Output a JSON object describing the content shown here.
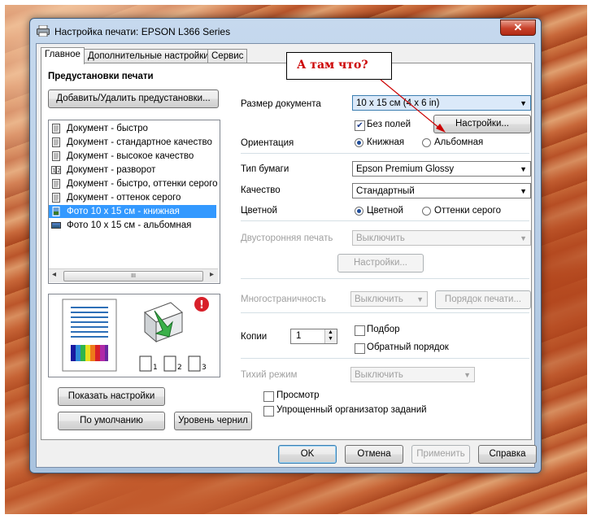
{
  "window": {
    "title": "Настройка печати: EPSON L366 Series",
    "close_glyph": "✕"
  },
  "tabs": [
    {
      "label": "Главное"
    },
    {
      "label": "Дополнительные настройки"
    },
    {
      "label": "Сервис"
    }
  ],
  "presets": {
    "heading": "Предустановки печати",
    "add_remove_button": "Добавить/Удалить предустановки...",
    "items": [
      {
        "label": "Документ - быстро",
        "icon": "document-icon"
      },
      {
        "label": "Документ - стандартное качество",
        "icon": "document-icon"
      },
      {
        "label": "Документ - высокое качество",
        "icon": "document-icon"
      },
      {
        "label": "Документ - разворот",
        "icon": "two-page-icon"
      },
      {
        "label": "Документ - быстро, оттенки серого",
        "icon": "document-icon"
      },
      {
        "label": "Документ - оттенок серого",
        "icon": "document-icon"
      },
      {
        "label": "Фото 10 x 15 см - книжная",
        "icon": "photo-portrait-icon",
        "selected": true
      },
      {
        "label": "Фото 10 x 15 см - альбомная",
        "icon": "photo-landscape-icon"
      }
    ],
    "scroll_thumb_glyph": "III",
    "scroll_left_glyph": "◂",
    "scroll_right_glyph": "▸"
  },
  "preview": {
    "copy_labels": [
      "1",
      "2",
      "3"
    ],
    "warning_glyph": "!"
  },
  "left_buttons": {
    "show_settings": "Показать настройки",
    "defaults": "По умолчанию",
    "ink_level": "Уровень чернил"
  },
  "settings": {
    "doc_size_label": "Размер документа",
    "doc_size_value": "10 x 15 см (4 x 6 in)",
    "borderless_label": "Без полей",
    "borderless_checked": true,
    "settings_button": "Настройки...",
    "orientation_label": "Ориентация",
    "orientation_portrait": "Книжная",
    "orientation_landscape": "Альбомная",
    "paper_type_label": "Тип бумаги",
    "paper_type_value": "Epson Premium Glossy",
    "quality_label": "Качество",
    "quality_value": "Стандартный",
    "color_label": "Цветной",
    "color_option": "Цветной",
    "grayscale_option": "Оттенки серого",
    "duplex_label": "Двусторонняя печать",
    "duplex_value": "Выключить",
    "duplex_settings_button": "Настройки...",
    "multipage_label": "Многостраничность",
    "multipage_value": "Выключить",
    "page_order_button": "Порядок печати...",
    "copies_label": "Копии",
    "copies_value": "1",
    "collate_label": "Подбор",
    "reverse_label": "Обратный порядок",
    "quiet_label": "Тихий режим",
    "quiet_value": "Выключить",
    "preview_label": "Просмотр",
    "job_arranger_label": "Упрощенный организатор заданий"
  },
  "footer": {
    "ok": "OK",
    "cancel": "Отмена",
    "apply": "Применить",
    "help": "Справка"
  },
  "annotation": {
    "text": "А там что?",
    "color": "#cc0000"
  }
}
